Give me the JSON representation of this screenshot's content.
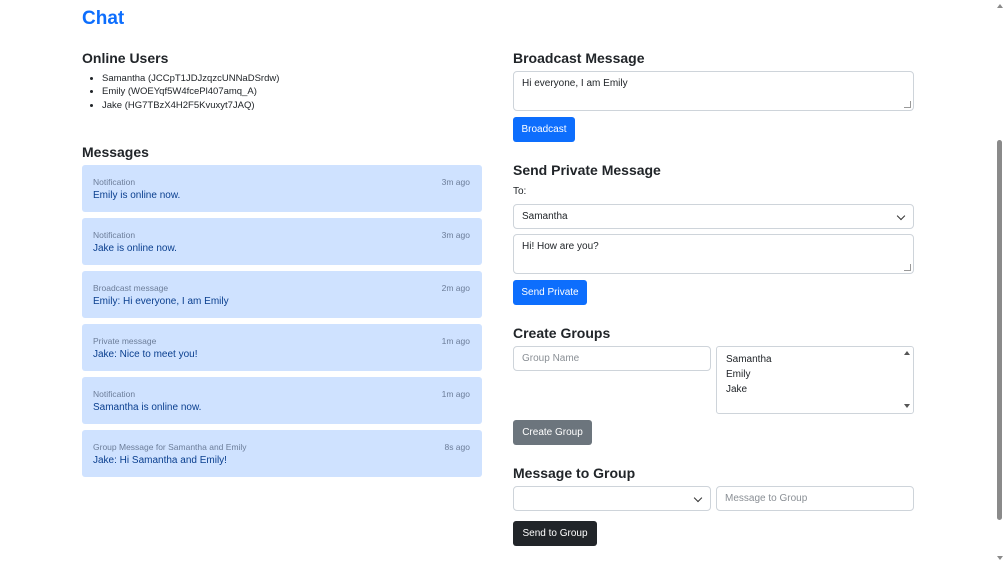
{
  "page_title": "Chat",
  "online_users": {
    "title": "Online Users",
    "users": [
      "Samantha (JCCpT1JDJzqzcUNNaDSrdw)",
      "Emily (WOEYqf5W4fcePl407amq_A)",
      "Jake (HG7TBzX4H2F5Kvuxyt7JAQ)"
    ]
  },
  "messages": {
    "title": "Messages",
    "items": [
      {
        "type": "Notification",
        "time": "3m ago",
        "text": "Emily is online now."
      },
      {
        "type": "Notification",
        "time": "3m ago",
        "text": "Jake is online now."
      },
      {
        "type": "Broadcast message",
        "time": "2m ago",
        "text": "Emily: Hi everyone, I am Emily"
      },
      {
        "type": "Private message",
        "time": "1m ago",
        "text": "Jake: Nice to meet you!"
      },
      {
        "type": "Notification",
        "time": "1m ago",
        "text": "Samantha is online now."
      },
      {
        "type": "Group Message for Samantha and Emily",
        "time": "8s ago",
        "text": "Jake: Hi Samantha and Emily!"
      }
    ]
  },
  "broadcast": {
    "title": "Broadcast Message",
    "value": "Hi everyone, I am Emily",
    "button": "Broadcast"
  },
  "private": {
    "title": "Send Private Message",
    "to_label": "To:",
    "recipient": "Samantha",
    "value": "Hi! How are you?",
    "button": "Send Private"
  },
  "groups": {
    "title": "Create Groups",
    "name_placeholder": "Group Name",
    "members": [
      "Samantha",
      "Emily",
      "Jake"
    ],
    "button": "Create Group"
  },
  "group_message": {
    "title": "Message to Group",
    "selected_group": "",
    "placeholder": "Message to Group",
    "button": "Send to Group"
  },
  "colors": {
    "accent": "#0d6efd",
    "message_bg": "#cfe2ff",
    "secondary": "#6c757d",
    "dark": "#212529"
  }
}
